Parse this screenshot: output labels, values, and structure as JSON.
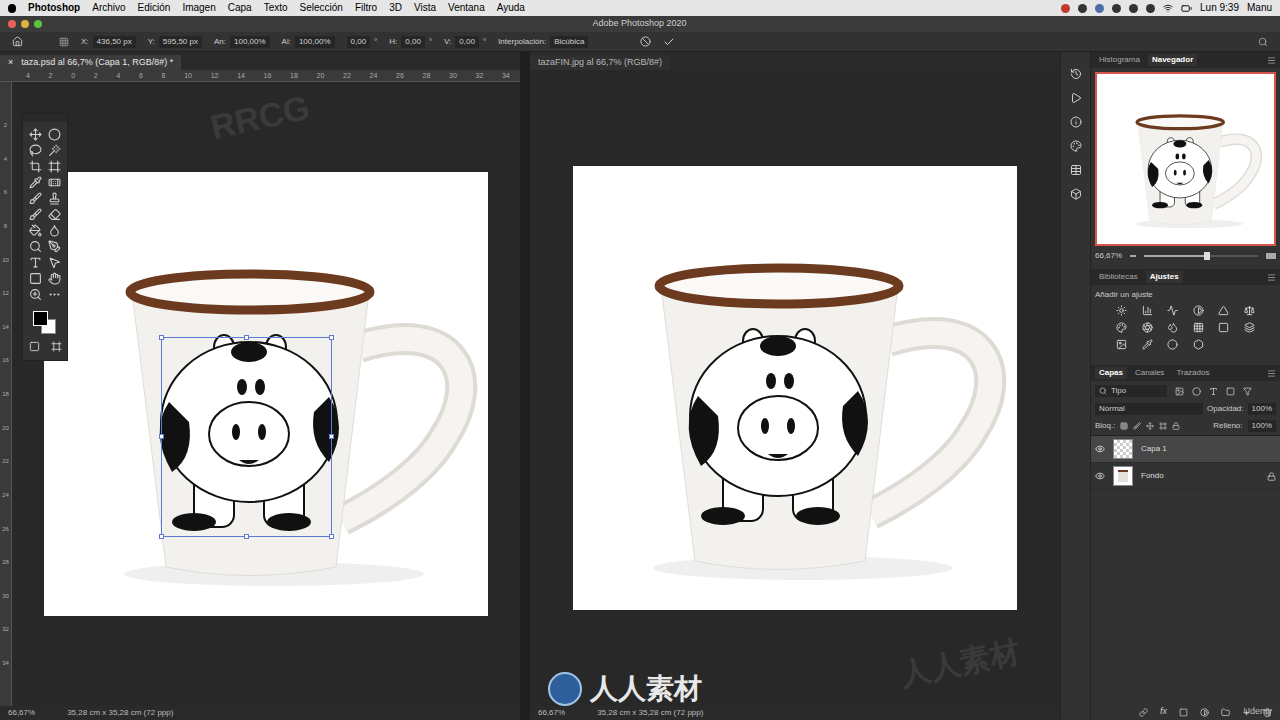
{
  "menubar": {
    "app": "Photoshop",
    "items": [
      "Archivo",
      "Edición",
      "Imagen",
      "Capa",
      "Texto",
      "Selección",
      "Filtro",
      "3D",
      "Vista",
      "Ventana",
      "Ayuda"
    ],
    "clock": "Lun 9:39",
    "user": "Manu"
  },
  "window": {
    "title": "Adobe Photoshop 2020"
  },
  "options": {
    "fields": [
      {
        "label": "X:",
        "value": "436,50 px",
        "unit": ""
      },
      {
        "label": "Y:",
        "value": "595,50 px",
        "unit": ""
      },
      {
        "label": "An:",
        "value": "100,00%",
        "unit": ""
      },
      {
        "label": "Al:",
        "value": "100,00%",
        "unit": ""
      },
      {
        "label": "",
        "value": "0,00",
        "unit": "°"
      },
      {
        "label": "H:",
        "value": "0,00",
        "unit": "°"
      },
      {
        "label": "V:",
        "value": "0,00",
        "unit": "°"
      }
    ],
    "interpolation_label": "Interpolación:",
    "interpolation": "Bicúbica"
  },
  "documents": [
    {
      "tab": "taza.psd al 66,7% (Capa 1, RGB/8#) *",
      "close": "×",
      "selected": true,
      "transform": true,
      "zoom": "66,67%",
      "size": "35,28 cm x 35,28 cm (72 ppp)",
      "ruler_h": [
        "4",
        "2",
        "0",
        "2",
        "4",
        "6",
        "8",
        "10",
        "12",
        "14",
        "16",
        "18",
        "20",
        "22",
        "24",
        "26",
        "28",
        "30",
        "32",
        "34"
      ],
      "ruler_v": [
        "2",
        "4",
        "6",
        "8",
        "10",
        "12",
        "14",
        "16",
        "18",
        "20",
        "22",
        "24",
        "26",
        "28",
        "30",
        "32",
        "34"
      ]
    },
    {
      "tab": "tazaFIN.jpg al 66,7% (RGB/8#)",
      "close": "",
      "selected": false,
      "transform": false,
      "zoom": "66,67%",
      "size": "35,28 cm x 35,28 cm (72 ppp)",
      "ruler_h": [],
      "ruler_v": []
    }
  ],
  "panels": {
    "top_tabs": [
      {
        "label": "Histograma",
        "selected": false
      },
      {
        "label": "Navegador",
        "selected": true
      }
    ],
    "navigator_zoom": "66,67%",
    "navigator_level": 0.55,
    "mid_tabs": [
      {
        "label": "Bibliotecas",
        "selected": false
      },
      {
        "label": "Ajustes",
        "selected": true
      }
    ],
    "adjust_hint": "Añadir un ajuste",
    "layer_tabs": [
      {
        "label": "Capas",
        "selected": true
      },
      {
        "label": "Canales",
        "selected": false
      },
      {
        "label": "Trazados",
        "selected": false
      }
    ],
    "filter": "Tipo",
    "blend": "Normal",
    "opacity_label": "Opacidad:",
    "opacity": "100%",
    "lock_label": "Bloq.:",
    "fill_label": "Relleno:",
    "fill": "100%",
    "layers": [
      {
        "name": "Capa 1",
        "selected": true,
        "visible": true,
        "locked": false,
        "kind": "transparent"
      },
      {
        "name": "Fondo",
        "selected": false,
        "visible": true,
        "locked": true,
        "kind": "image"
      }
    ],
    "footer": "fx"
  },
  "watermarks": [
    "RRCG",
    "人人素材"
  ],
  "brand": "人人素材",
  "udemy": "Udemy"
}
